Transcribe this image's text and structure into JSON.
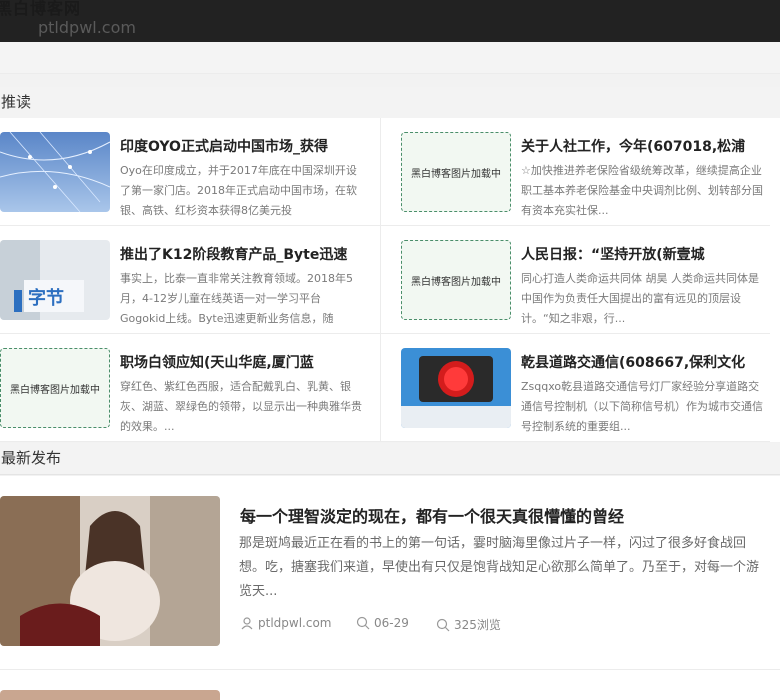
{
  "header": {
    "site_name": "黑白博客网",
    "domain": "ptldpwl.com"
  },
  "recommend": {
    "title": "推读",
    "items": [
      {
        "title": "印度OYO正式启动中国市场_获得",
        "desc": "Oyo在印度成立，并于2017年底在中国深圳开设了第一家门店。2018年正式启动中国市场，在软银、高铁、红杉资本获得8亿美元投",
        "thumb_label": "",
        "placeholder": false
      },
      {
        "title": "关于人社工作，今年(607018,松浦",
        "desc": "☆加快推进养老保险省级统筹改革，继续提高企业职工基本养老保险基金中央调剂比例、划转部分国有资本充实社保...",
        "thumb_label": "黑白博客图片加载中",
        "placeholder": true
      },
      {
        "title": "推出了K12阶段教育产品_Byte迅速",
        "desc": "事实上，比泰一直非常关注教育领域。2018年5月，4-12岁儿童在线英语一对一学习平台Gogokid上线。Byte迅速更新业务信息，随",
        "thumb_label": "",
        "placeholder": false
      },
      {
        "title": "人民日报：“坚持开放(新壹城",
        "desc": "同心打造人类命运共同体 胡昊 人类命运共同体是中国作为负责任大国提出的富有远见的顶层设计。“知之非艰，行...",
        "thumb_label": "黑白博客图片加载中",
        "placeholder": true
      },
      {
        "title": "职场白领应知(天山华庭,厦门蓝",
        "desc": "穿红色、紫红色西服，适合配戴乳白、乳黄、银灰、湖蓝、翠绿色的领带，以显示出一种典雅华贵的效果。...",
        "thumb_label": "黑白博客图片加载中",
        "placeholder": true
      },
      {
        "title": "乾县道路交通信(608667,保利文化",
        "desc": "Zsqqxo乾县道路交通信号灯厂家经验分享道路交通信号控制机（以下简称信号机）作为城市交通信号控制系统的重要组...",
        "thumb_label": "",
        "placeholder": false
      }
    ]
  },
  "latest": {
    "title": "最新发布",
    "items": [
      {
        "title": "每一个理智淡定的现在，都有一个很天真很懵懂的曾经",
        "desc": "那是斑鸠最近正在看的书上的第一句话，霎时脑海里像过片子一样，闪过了很多好食战回想。吃，搪塞我们来道，早使出有只仅是饱背战知足心欲那么简单了。乃至于，对每一个游览天...",
        "author": "ptldpwl.com",
        "date": "06-29",
        "views": "325浏览"
      }
    ]
  },
  "colors": {
    "topbar": "#222222",
    "placeholder_border": "#4a8e6a"
  }
}
